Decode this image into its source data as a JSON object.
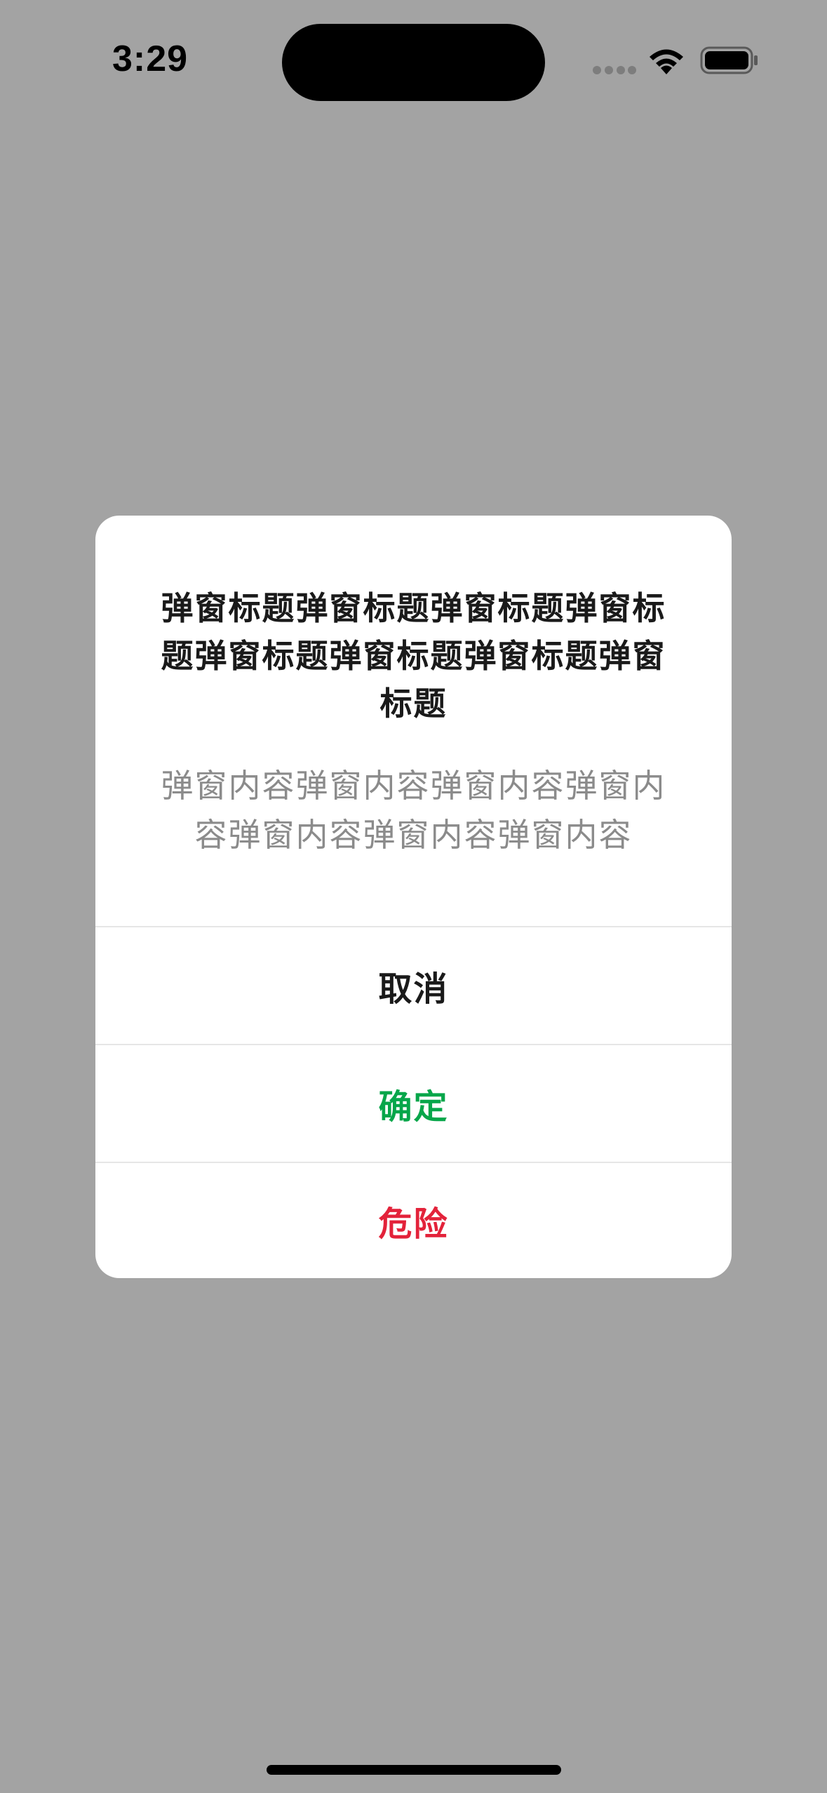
{
  "status_bar": {
    "time": "3:29",
    "icons": [
      "signal-icon",
      "wifi-icon",
      "battery-icon"
    ]
  },
  "dialog": {
    "title": "弹窗标题弹窗标题弹窗标题弹窗标题弹窗标题弹窗标题弹窗标题弹窗标题",
    "message": "弹窗内容弹窗内容弹窗内容弹窗内容弹窗内容弹窗内容弹窗内容",
    "actions": [
      {
        "label": "取消",
        "color": "#1a1a1a"
      },
      {
        "label": "确定",
        "color": "#07a64a"
      },
      {
        "label": "危险",
        "color": "#e3223a"
      }
    ]
  },
  "colors": {
    "overlay": "#a3a3a3",
    "dialog_background": "#ffffff",
    "message_text": "#8b8b8b",
    "confirm": "#07a64a",
    "danger": "#e3223a"
  }
}
